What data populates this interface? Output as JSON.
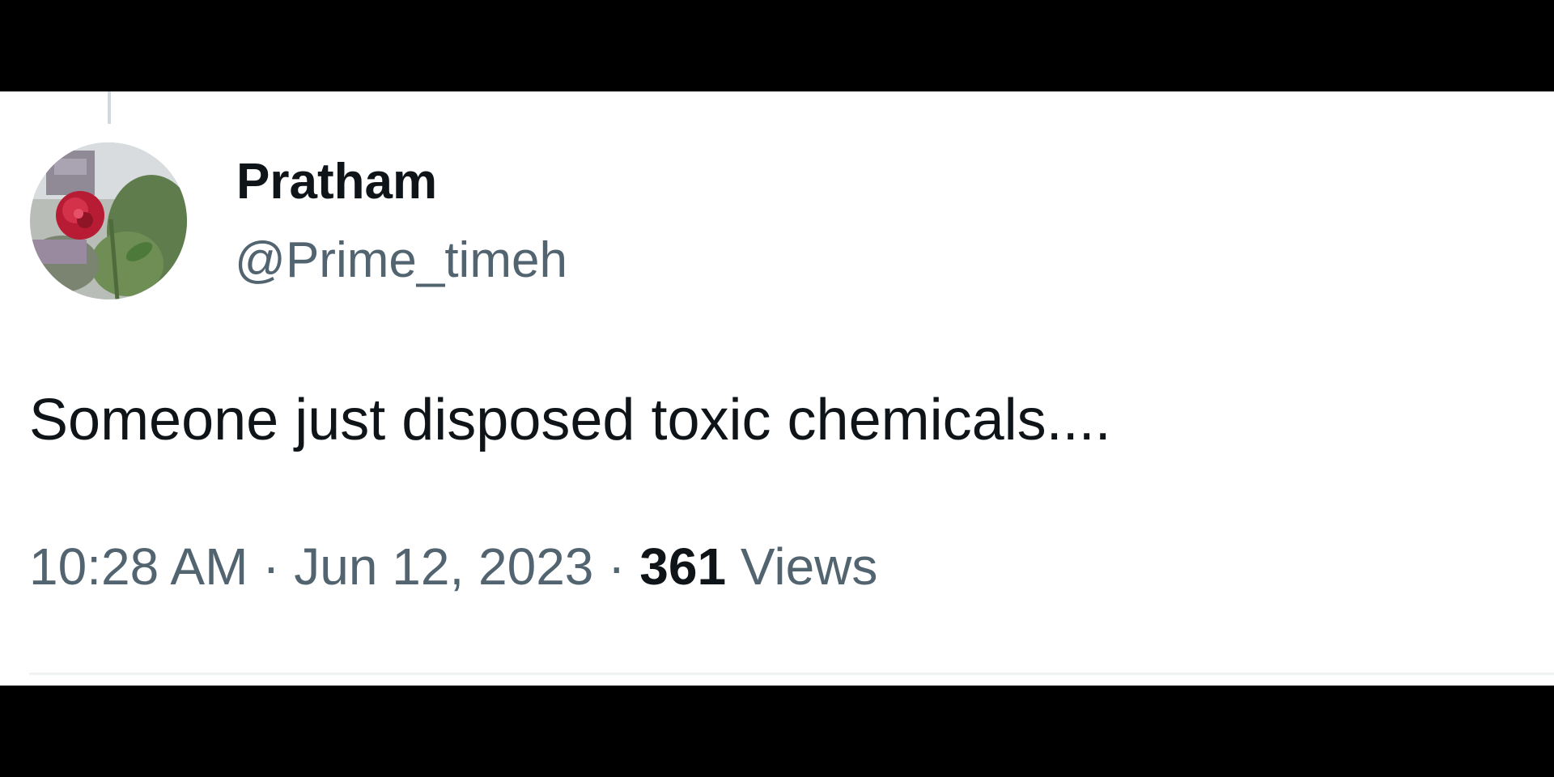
{
  "tweet": {
    "author": {
      "display_name": "Pratham",
      "handle": "@Prime_timeh",
      "avatar_icon": "rose-flower-avatar"
    },
    "text": "Someone just disposed toxic chemicals....",
    "time": "10:28 AM",
    "separator": "·",
    "date": "Jun 12, 2023",
    "views_count": "361",
    "views_label": "Views"
  },
  "colors": {
    "primary_text": "#0f1419",
    "secondary_text": "#536471",
    "background": "#ffffff",
    "letterbox": "#000000"
  }
}
